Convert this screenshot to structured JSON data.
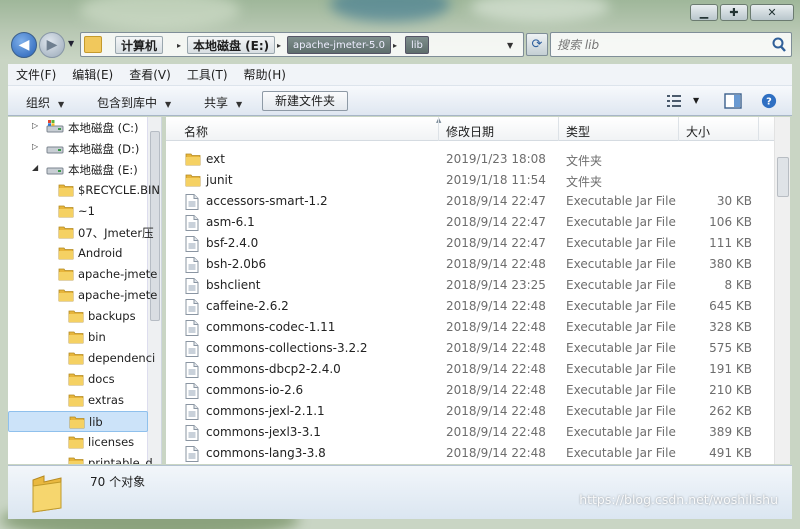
{
  "window": {
    "caption_buttons": [
      "minimize",
      "maximize",
      "close"
    ]
  },
  "address": {
    "crumbs": [
      "计算机",
      "本地磁盘 (E:)",
      "apache-jmeter-5.0",
      "lib"
    ],
    "search_placeholder": "搜索 lib"
  },
  "menu": [
    "文件(F)",
    "编辑(E)",
    "查看(V)",
    "工具(T)",
    "帮助(H)"
  ],
  "toolbar": {
    "organize": "组织",
    "include_in_library": "包含到库中",
    "share": "共享",
    "new_folder": "新建文件夹"
  },
  "nav_tree": [
    {
      "label": "本地磁盘 (C:)",
      "kind": "drive-win",
      "indent": 0
    },
    {
      "label": "本地磁盘 (D:)",
      "kind": "drive",
      "indent": 0
    },
    {
      "label": "本地磁盘 (E:)",
      "kind": "drive",
      "indent": 0
    },
    {
      "label": "$RECYCLE.BIN",
      "kind": "folder",
      "indent": 1
    },
    {
      "label": "~1",
      "kind": "folder",
      "indent": 1
    },
    {
      "label": "07、Jmeter压",
      "kind": "folder",
      "indent": 1
    },
    {
      "label": "Android",
      "kind": "folder",
      "indent": 1
    },
    {
      "label": "apache-jmete",
      "kind": "folder",
      "indent": 1
    },
    {
      "label": "apache-jmete",
      "kind": "folder",
      "indent": 1
    },
    {
      "label": "backups",
      "kind": "folder",
      "indent": 2
    },
    {
      "label": "bin",
      "kind": "folder",
      "indent": 2
    },
    {
      "label": "dependenci",
      "kind": "folder",
      "indent": 2
    },
    {
      "label": "docs",
      "kind": "folder",
      "indent": 2
    },
    {
      "label": "extras",
      "kind": "folder",
      "indent": 2
    },
    {
      "label": "lib",
      "kind": "folder",
      "indent": 2,
      "selected": true
    },
    {
      "label": "licenses",
      "kind": "folder",
      "indent": 2
    },
    {
      "label": "printable_d",
      "kind": "folder",
      "indent": 2
    }
  ],
  "columns": {
    "name": "名称",
    "date": "修改日期",
    "type": "类型",
    "size": "大小"
  },
  "files": [
    {
      "name": "ext",
      "date": "2019/1/23 18:08",
      "type": "文件夹",
      "size": "",
      "kind": "folder"
    },
    {
      "name": "junit",
      "date": "2019/1/18 11:54",
      "type": "文件夹",
      "size": "",
      "kind": "folder"
    },
    {
      "name": "accessors-smart-1.2",
      "date": "2018/9/14 22:47",
      "type": "Executable Jar File",
      "size": "30 KB",
      "kind": "jar"
    },
    {
      "name": "asm-6.1",
      "date": "2018/9/14 22:47",
      "type": "Executable Jar File",
      "size": "106 KB",
      "kind": "jar"
    },
    {
      "name": "bsf-2.4.0",
      "date": "2018/9/14 22:47",
      "type": "Executable Jar File",
      "size": "111 KB",
      "kind": "jar"
    },
    {
      "name": "bsh-2.0b6",
      "date": "2018/9/14 22:48",
      "type": "Executable Jar File",
      "size": "380 KB",
      "kind": "jar"
    },
    {
      "name": "bshclient",
      "date": "2018/9/14 23:25",
      "type": "Executable Jar File",
      "size": "8 KB",
      "kind": "jar"
    },
    {
      "name": "caffeine-2.6.2",
      "date": "2018/9/14 22:48",
      "type": "Executable Jar File",
      "size": "645 KB",
      "kind": "jar"
    },
    {
      "name": "commons-codec-1.11",
      "date": "2018/9/14 22:48",
      "type": "Executable Jar File",
      "size": "328 KB",
      "kind": "jar"
    },
    {
      "name": "commons-collections-3.2.2",
      "date": "2018/9/14 22:48",
      "type": "Executable Jar File",
      "size": "575 KB",
      "kind": "jar"
    },
    {
      "name": "commons-dbcp2-2.4.0",
      "date": "2018/9/14 22:48",
      "type": "Executable Jar File",
      "size": "191 KB",
      "kind": "jar"
    },
    {
      "name": "commons-io-2.6",
      "date": "2018/9/14 22:48",
      "type": "Executable Jar File",
      "size": "210 KB",
      "kind": "jar"
    },
    {
      "name": "commons-jexl-2.1.1",
      "date": "2018/9/14 22:48",
      "type": "Executable Jar File",
      "size": "262 KB",
      "kind": "jar"
    },
    {
      "name": "commons-jexl3-3.1",
      "date": "2018/9/14 22:48",
      "type": "Executable Jar File",
      "size": "389 KB",
      "kind": "jar"
    },
    {
      "name": "commons-lang3-3.8",
      "date": "2018/9/14 22:48",
      "type": "Executable Jar File",
      "size": "491 KB",
      "kind": "jar"
    }
  ],
  "details": {
    "count": "70 个对象"
  },
  "watermark": "https://blog.csdn.net/woshilishu"
}
